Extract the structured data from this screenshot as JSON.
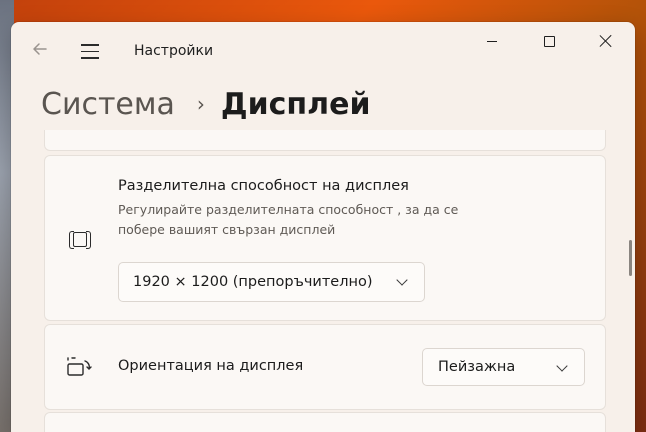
{
  "window": {
    "app_title": "Настройки"
  },
  "breadcrumb": {
    "parent": "Система",
    "separator": "›",
    "current": "Дисплей"
  },
  "resolution": {
    "title": "Разделителна способност на дисплея",
    "description": "Регулирайте разделителната способност , за да се побере вашият свързан дисплей",
    "selected": "1920 × 1200 (препоръчително)"
  },
  "orientation": {
    "label": "Ориентация на дисплея",
    "selected": "Пейзажна"
  },
  "icons": {
    "back": "back-arrow-icon",
    "menu": "hamburger-menu-icon",
    "resolution": "resolution-icon",
    "orientation": "rotate-display-icon"
  }
}
